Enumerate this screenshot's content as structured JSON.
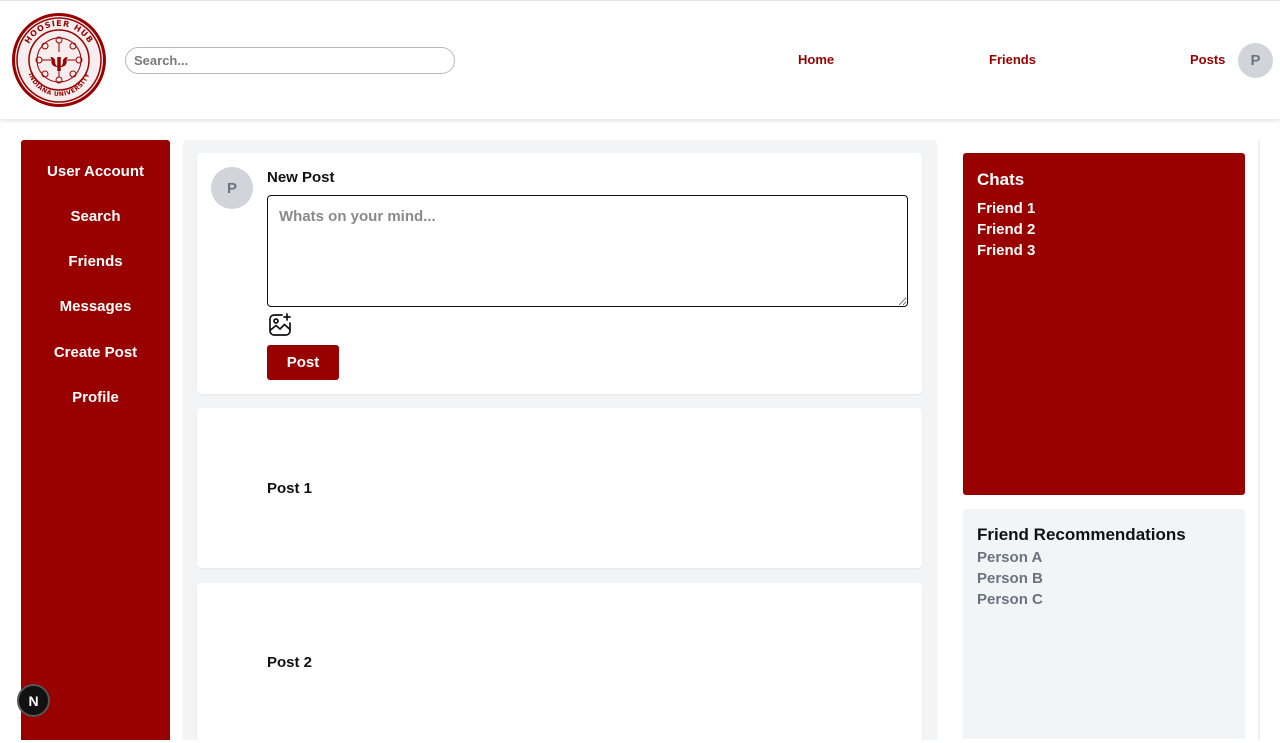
{
  "header": {
    "logo_texts": {
      "top": "HOOSIER HUB",
      "bottom": "INDIANA UNIVERSITY",
      "center": "ψ"
    },
    "search_placeholder": "Search...",
    "nav": {
      "home": "Home",
      "friends": "Friends",
      "posts": "Posts"
    },
    "avatar_initial": "P"
  },
  "sidebar": {
    "items": [
      {
        "label": "User Account"
      },
      {
        "label": "Search"
      },
      {
        "label": "Friends"
      },
      {
        "label": "Messages"
      },
      {
        "label": "Create Post"
      },
      {
        "label": "Profile"
      }
    ]
  },
  "composer": {
    "avatar_initial": "P",
    "title": "New Post",
    "placeholder": "Whats on your mind...",
    "post_button": "Post"
  },
  "feed": {
    "posts": [
      {
        "label": "Post 1"
      },
      {
        "label": "Post 2"
      }
    ]
  },
  "chats": {
    "title": "Chats",
    "items": [
      "Friend 1",
      "Friend 2",
      "Friend 3"
    ]
  },
  "recommendations": {
    "title": "Friend Recommendations",
    "items": [
      "Person A",
      "Person B",
      "Person C"
    ]
  },
  "badge": {
    "label": "N"
  },
  "colors": {
    "brand": "#990000",
    "muted": "#6b7280",
    "panel": "#f3f4f6"
  },
  "icons": {
    "image": "image-add-icon",
    "logo": "hoosier-hub-seal-logo"
  }
}
